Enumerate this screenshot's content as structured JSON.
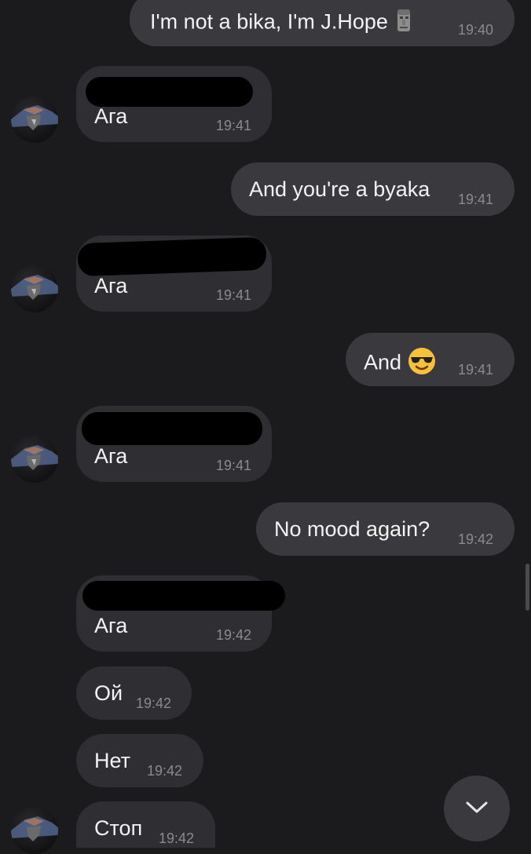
{
  "messages": [
    {
      "text": "I'm not a bika, I'm J.Hope",
      "emoji": "moai",
      "time": "19:40",
      "direction": "outgoing"
    },
    {
      "text": "Ага",
      "time": "19:41",
      "direction": "incoming",
      "reply_redacted": true
    },
    {
      "text": "And you're a byaka",
      "time": "19:41",
      "direction": "outgoing"
    },
    {
      "text": "Ага",
      "time": "19:41",
      "direction": "incoming",
      "reply_redacted": true
    },
    {
      "text": "And",
      "emoji": "smiling-face-with-sunglasses",
      "time": "19:41",
      "direction": "outgoing"
    },
    {
      "text": "Ага",
      "time": "19:41",
      "direction": "incoming",
      "reply_redacted": true
    },
    {
      "text": "No mood again?",
      "time": "19:42",
      "direction": "outgoing"
    },
    {
      "text": "Ага",
      "time": "19:42",
      "direction": "incoming",
      "reply_redacted": true
    },
    {
      "text": "Ой",
      "time": "19:42",
      "direction": "incoming"
    },
    {
      "text": "Нет",
      "time": "19:42",
      "direction": "incoming"
    },
    {
      "text": "Стоп",
      "time": "19:42",
      "direction": "incoming"
    }
  ],
  "controls": {
    "scroll_down_icon": "chevron-down-icon"
  },
  "colors": {
    "background": "#1b1b1d",
    "outgoing_bubble": "#3a3a3e",
    "incoming_bubble": "#2f2f33",
    "timestamp": "#8a8a8f"
  }
}
